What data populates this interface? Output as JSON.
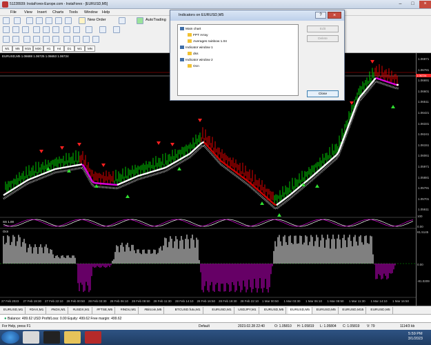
{
  "window": {
    "title": "51228939: InstaForex-Europe.com - InstaForex - [EURUSD,M5]"
  },
  "menu": [
    "File",
    "View",
    "Insert",
    "Charts",
    "Tools",
    "Window",
    "Help"
  ],
  "toolbar": {
    "new_order": "New Order",
    "autotrading": "AutoTrading",
    "timeframes": [
      "M1",
      "M5",
      "M15",
      "M30",
      "H1",
      "H4",
      "D1",
      "W1",
      "MN"
    ]
  },
  "chart": {
    "title": "EURUSD,M5  1.06688 1.06725 1.06653 1.06724",
    "current_price_label": "1.06724",
    "price_ticks": [
      "1.06871",
      "1.06781",
      "1.06691",
      "1.06601",
      "1.06511",
      "1.06421",
      "1.06331",
      "1.06241",
      "1.06151",
      "1.06061",
      "1.05971",
      "1.05881",
      "1.05791",
      "1.05701",
      "1.05611"
    ],
    "sub1_label": "SS 1.00",
    "sub1_ticks": [
      "100",
      "0.00"
    ],
    "sub2_label": "Ocn",
    "sub2_ticks": [
      "81.5145",
      "0.00",
      "-81.0209"
    ],
    "time_ticks": [
      "27 Feb 2023",
      "27 Feb 19:30",
      "27 Feb 22:10",
      "28 Feb 00:50",
      "28 Feb 03:30",
      "28 Feb 06:10",
      "28 Feb 08:50",
      "28 Feb 11:30",
      "28 Feb 14:10",
      "28 Feb 16:50",
      "28 Feb 19:30",
      "28 Feb 22:10",
      "1 Mar 00:50",
      "1 Mar 03:30",
      "1 Mar 06:10",
      "1 Mar 08:50",
      "1 Mar 11:30",
      "1 Mar 14:10",
      "1 Mar 16:50"
    ]
  },
  "dialog": {
    "title": "Indicators on EURUSD,M5",
    "tree": [
      {
        "label": "Main chart",
        "level": 0
      },
      {
        "label": "FPT Array",
        "level": 1
      },
      {
        "label": "Averages rainbow 1.04",
        "level": 1
      },
      {
        "label": "Indicator window 1",
        "level": 0
      },
      {
        "label": "dss",
        "level": 1
      },
      {
        "label": "Indicator window 2",
        "level": 0
      },
      {
        "label": "Ocn",
        "level": 1
      }
    ],
    "edit": "Edit",
    "delete": "Delete",
    "close": "Close"
  },
  "tabs": [
    "EURUSD,M1",
    "#DAX,M1",
    "#NDX,M1",
    "#USDX,M1",
    "#FTSE,M5",
    "#INDU,M1",
    "#Bitcoin,M5",
    "BTCUSD.futu,M1",
    "EURUSD,M1",
    "USDJPY,M1",
    "EURUSD,M5",
    "EURUSD,M5",
    "EURUSD,M5",
    "EURUSD,M15",
    "EURUSD,M5"
  ],
  "balance": "Balance: 499.62 USD  Profit/Loss: 0.00  Equity: 499.62  Free margin: 499.62",
  "status": {
    "help": "For Help, press F1",
    "profile": "Default",
    "time": "2023.02.28 22:40",
    "open": "O: 1.05810",
    "high": "H: 1.05819",
    "low": "L: 1.05804",
    "close": "C: 1.05819",
    "vol": "V: 79",
    "traffic": "1114/3 kb"
  },
  "clock": {
    "time": "5:59 PM",
    "date": "3/1/2023"
  },
  "colors": {
    "bull": "#00cc00",
    "bear": "#dd0000",
    "line_up": "#ffffff",
    "line_down": "#dd00dd",
    "ocn_pos": "#ffffff",
    "ocn_neg": "#cc00cc"
  }
}
